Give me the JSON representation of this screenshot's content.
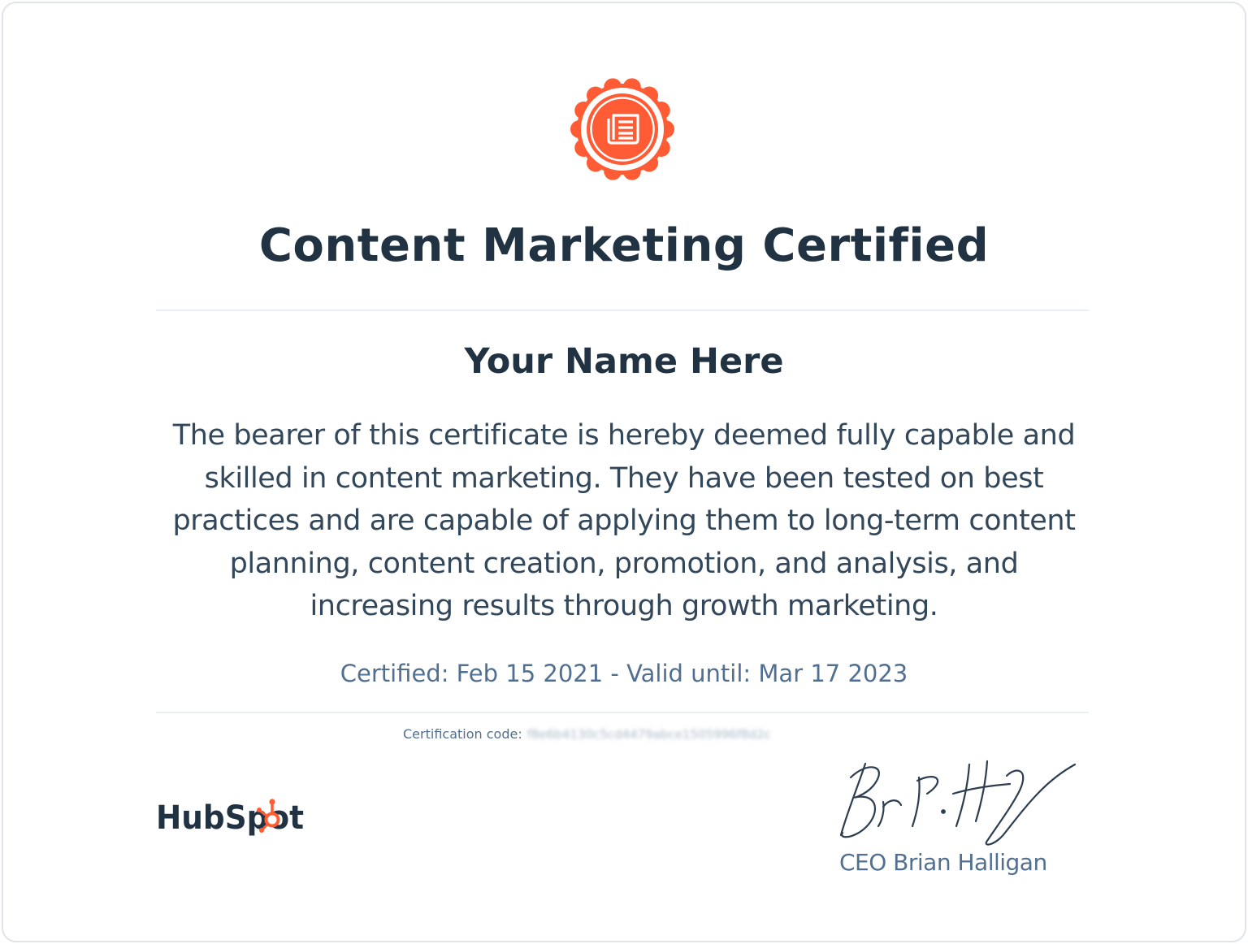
{
  "certificate": {
    "title": "Content Marketing Certified",
    "recipient": "Your Name Here",
    "description": [
      "The bearer of this certificate is hereby deemed fully capable and",
      "skilled in content marketing. They have been tested on best",
      "practices and are capable of applying them to long-term content",
      "planning, content creation, promotion, and analysis, and",
      "increasing results through growth marketing."
    ],
    "dates": "Certified: Feb 15 2021 - Valid until: Mar 17 2023",
    "code_label": "Certification code:",
    "code_value": "f8e6b4130c5cd4479abce1505996f8d2c"
  },
  "branding": {
    "logo_text": "HubSpot",
    "accent_color": "#ff5c35",
    "text_color": "#213343",
    "seal_icon": "newspaper-icon"
  },
  "signatory": {
    "title": "CEO Brian Halligan"
  }
}
